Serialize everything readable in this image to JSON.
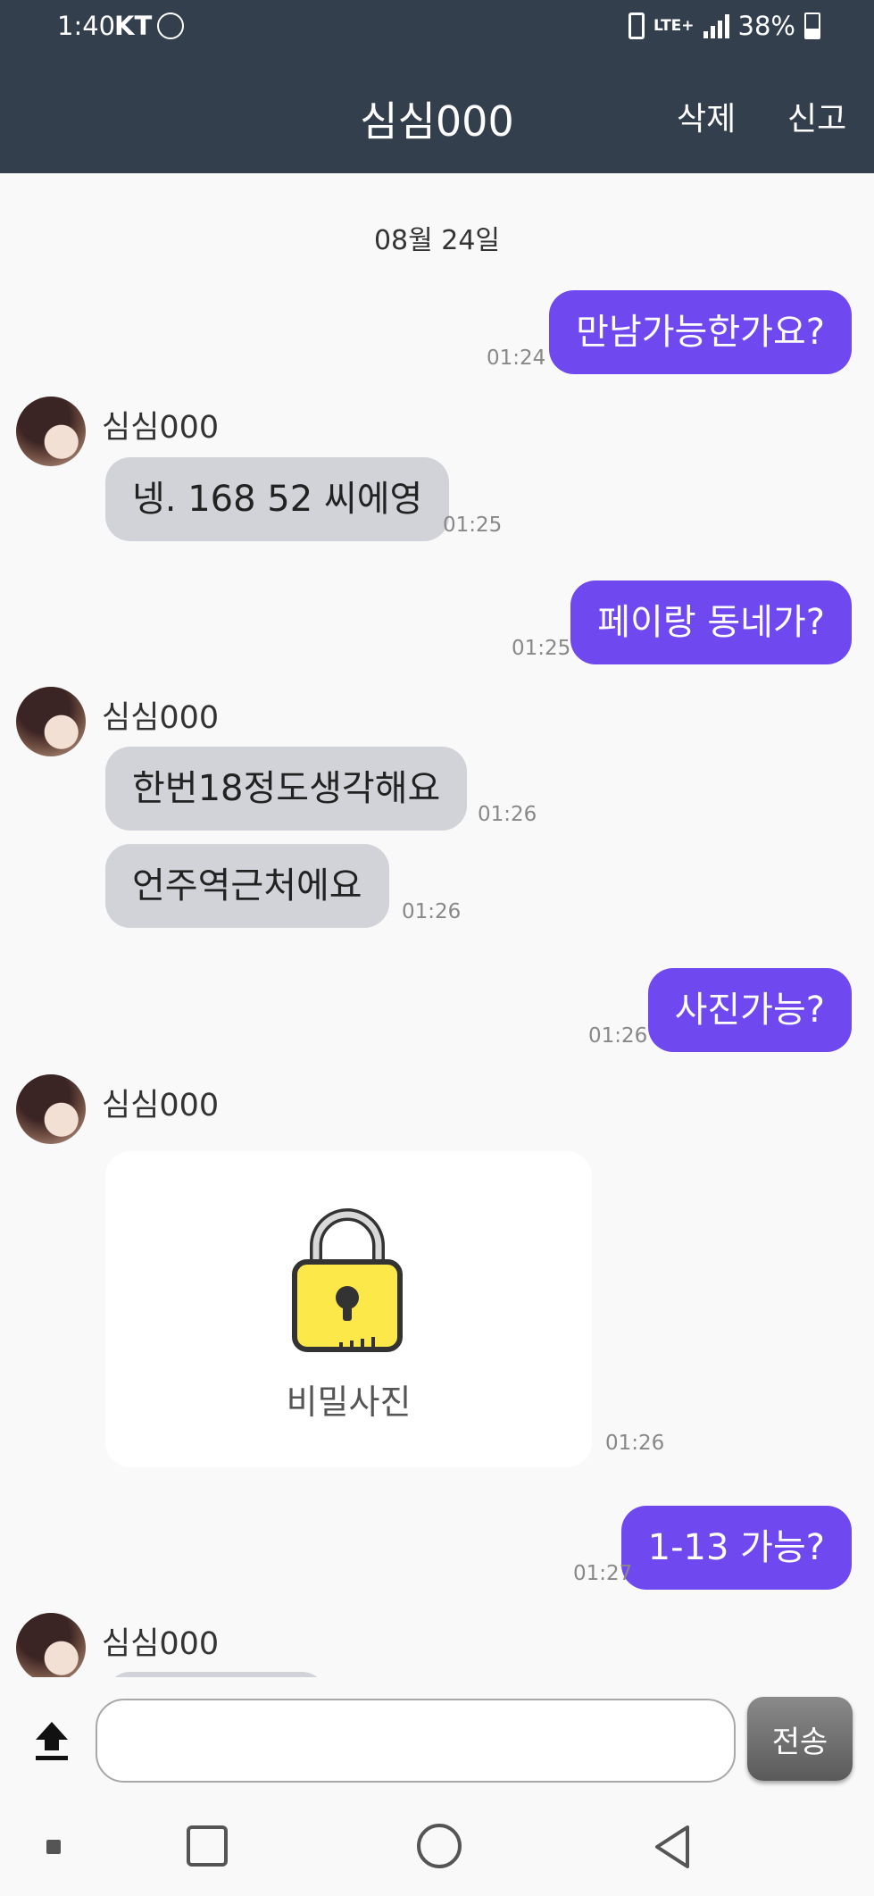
{
  "status": {
    "time": "1:40",
    "carrier": "KT",
    "network": "LTE+",
    "battery": "38%"
  },
  "header": {
    "title": "심심000",
    "delete_label": "삭제",
    "report_label": "신고"
  },
  "chat": {
    "date": "08월 24일",
    "partner_name": "심심000",
    "messages": [
      {
        "side": "sent",
        "text": "만남가능한가요?",
        "time": "01:24"
      },
      {
        "side": "received",
        "text": "넹. 168 52 씨에영",
        "time": "01:25"
      },
      {
        "side": "sent",
        "text": "페이랑 동네가?",
        "time": "01:25"
      },
      {
        "side": "received",
        "text": "한번18정도생각해요",
        "time": "01:26"
      },
      {
        "side": "received",
        "text": "언주역근처에요",
        "time": "01:26"
      },
      {
        "side": "sent",
        "text": "사진가능?",
        "time": "01:26"
      },
      {
        "side": "received",
        "type": "secret_photo",
        "text": "비밀사진",
        "time": "01:26"
      },
      {
        "side": "sent",
        "text": "1-13 가능?",
        "time": "01:27"
      }
    ]
  },
  "input": {
    "value": "",
    "placeholder": "",
    "send_label": "전송"
  }
}
